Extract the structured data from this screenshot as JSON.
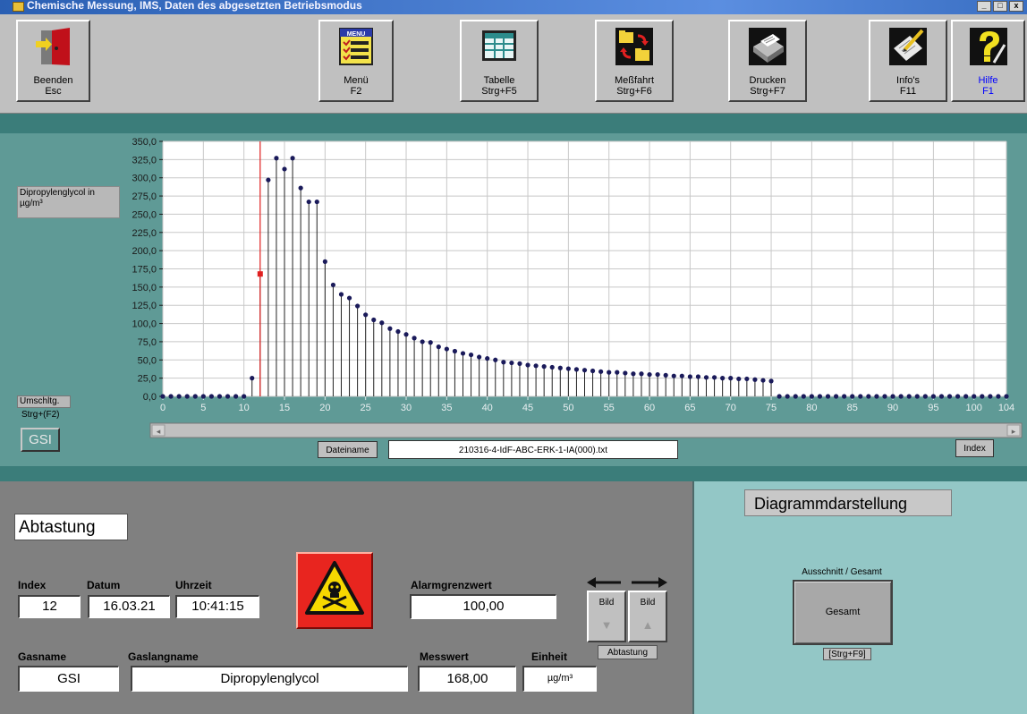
{
  "window": {
    "title": "Chemische Messung, IMS, Daten des abgesetzten Betriebsmodus"
  },
  "toolbar": {
    "buttons": [
      {
        "line1": "Beenden",
        "line2": "Esc",
        "icon": "exit-door-icon"
      },
      {
        "line1": "Menü",
        "line2": "F2",
        "icon": "menu-icon"
      },
      {
        "line1": "Tabelle",
        "line2": "Strg+F5",
        "icon": "table-icon"
      },
      {
        "line1": "Meßfahrt",
        "line2": "Strg+F6",
        "icon": "folders-transfer-icon"
      },
      {
        "line1": "Drucken",
        "line2": "Strg+F7",
        "icon": "printer-icon"
      },
      {
        "line1": "Info's",
        "line2": "F11",
        "icon": "info-pen-icon"
      },
      {
        "line1": "Hilfe",
        "line2": "F1",
        "icon": "help-icon"
      }
    ],
    "menu_icon_text": "MENU"
  },
  "chart_panel": {
    "y_label": "Dipropylenglycol in µg/m³",
    "umschalt_line1": "Umschltg.",
    "umschalt_line2": "Strg+(F2)",
    "gas_short": "GSI",
    "dateiname_label": "Dateiname",
    "dateiname_value": "210316-4-IdF-ABC-ERK-1-IA(000).txt",
    "index_label": "Index"
  },
  "chart_data": {
    "type": "stem",
    "xlim": [
      0,
      104
    ],
    "ylim": [
      0,
      350
    ],
    "x_ticks": [
      0,
      5,
      10,
      15,
      20,
      25,
      30,
      35,
      40,
      45,
      50,
      55,
      60,
      65,
      70,
      75,
      80,
      85,
      90,
      95,
      100,
      104
    ],
    "y_ticks": [
      "0,0",
      "25,0",
      "50,0",
      "75,0",
      "100,0",
      "125,0",
      "150,0",
      "175,0",
      "200,0",
      "225,0",
      "250,0",
      "275,0",
      "300,0",
      "325,0",
      "350,0"
    ],
    "cursor_index": 12,
    "cursor_value": 168,
    "grid": true,
    "values": [
      0,
      0,
      0,
      0,
      0,
      0,
      0,
      0,
      0,
      0,
      0,
      25,
      168,
      297,
      327,
      312,
      327,
      286,
      267,
      267,
      185,
      153,
      140,
      135,
      124,
      112,
      105,
      101,
      93,
      89,
      85,
      80,
      75,
      74,
      68,
      65,
      62,
      59,
      57,
      54,
      52,
      50,
      47,
      46,
      45,
      43,
      42,
      41,
      40,
      39,
      38,
      37,
      36,
      35,
      34,
      33,
      33,
      32,
      31,
      31,
      30,
      30,
      29,
      28,
      28,
      27,
      27,
      26,
      26,
      25,
      25,
      24,
      24,
      23,
      22,
      21,
      0,
      0,
      0,
      0,
      0,
      0,
      0,
      0,
      0,
      0,
      0,
      0,
      0,
      0,
      0,
      0,
      0,
      0,
      0,
      0,
      0,
      0,
      0,
      0,
      0,
      0,
      0,
      0,
      0
    ]
  },
  "abtastung": {
    "title": "Abtastung",
    "index_label": "Index",
    "index_value": "12",
    "datum_label": "Datum",
    "datum_value": "16.03.21",
    "uhrzeit_label": "Uhrzeit",
    "uhrzeit_value": "10:41:15",
    "alarm_label": "Alarmgrenzwert",
    "alarm_value": "100,00",
    "gasname_label": "Gasname",
    "gasname_value": "GSI",
    "gaslang_label": "Gaslangname",
    "gaslang_value": "Dipropylenglycol",
    "messwert_label": "Messwert",
    "messwert_value": "168,00",
    "einheit_label": "Einheit",
    "einheit_value": "µg/m³",
    "bild_left": "Bild",
    "bild_right": "Bild",
    "abtastung_small": "Abtastung"
  },
  "diagramm": {
    "title": "Diagrammdarstellung",
    "ausschnitt_label": "Ausschnitt / Gesamt",
    "gesamt_button": "Gesamt",
    "shortcut": "[Strg+F9]"
  },
  "colors": {
    "teal_dark": "#3b7d7a",
    "teal_panel": "#5f9a96",
    "teal_light": "#93c7c6",
    "marker": "#1a1a5a",
    "cursor": "#e02020",
    "help_text": "#0000ff"
  }
}
